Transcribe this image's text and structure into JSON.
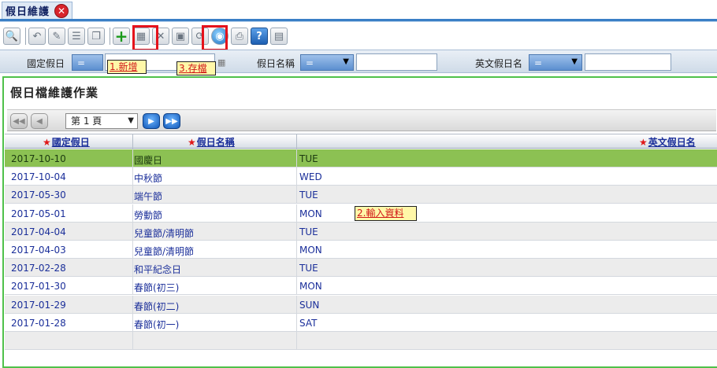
{
  "window": {
    "title": "假日維護"
  },
  "toolbar": {
    "buttons": [
      {
        "name": "query-icon",
        "glyph": "🔍"
      },
      {
        "name": "undo-icon",
        "glyph": "↶"
      },
      {
        "name": "edit-icon",
        "glyph": "✎"
      },
      {
        "name": "list-icon",
        "glyph": "☰"
      },
      {
        "name": "copy-icon",
        "glyph": "❐"
      },
      {
        "name": "add-icon",
        "glyph": "+"
      },
      {
        "name": "grid-add-icon",
        "glyph": "▦"
      },
      {
        "name": "delete-icon",
        "glyph": "✕"
      },
      {
        "name": "save-icon",
        "glyph": "▣"
      },
      {
        "name": "refresh-icon",
        "glyph": "⟳"
      },
      {
        "name": "globe-icon",
        "glyph": "◉"
      },
      {
        "name": "print-icon",
        "glyph": "⎙"
      },
      {
        "name": "help-icon",
        "glyph": "?"
      },
      {
        "name": "export-icon",
        "glyph": "▤"
      }
    ]
  },
  "filter": {
    "fixed_date_label": "國定假日",
    "fixed_date_op": "=",
    "name_label": "假日名稱",
    "name_op": "=",
    "en_name_label": "英文假日名",
    "en_name_op": "="
  },
  "annotations": {
    "add": "1.新增",
    "save": "3.存檔",
    "input": "2.輸入資料"
  },
  "panel": {
    "title": "假日檔維護作業"
  },
  "pager": {
    "page_label": "第 1 頁"
  },
  "grid": {
    "columns": [
      "國定假日",
      "假日名稱",
      "英文假日名"
    ],
    "rows": [
      [
        "2017-10-10",
        "國慶日",
        "TUE"
      ],
      [
        "2017-10-04",
        "中秋節",
        "WED"
      ],
      [
        "2017-05-30",
        "端午節",
        "TUE"
      ],
      [
        "2017-05-01",
        "勞動節",
        "MON"
      ],
      [
        "2017-04-04",
        "兒童節/清明節",
        "TUE"
      ],
      [
        "2017-04-03",
        "兒童節/清明節",
        "MON"
      ],
      [
        "2017-02-28",
        "和平紀念日",
        "TUE"
      ],
      [
        "2017-01-30",
        "春節(初三)",
        "MON"
      ],
      [
        "2017-01-29",
        "春節(初二)",
        "SUN"
      ],
      [
        "2017-01-28",
        "春節(初一)",
        "SAT"
      ],
      [
        "",
        "",
        ""
      ]
    ]
  },
  "colors": {
    "selected_row": "#8cc153",
    "panel_border": "#4fc14a",
    "highlight": "#e5121b"
  }
}
